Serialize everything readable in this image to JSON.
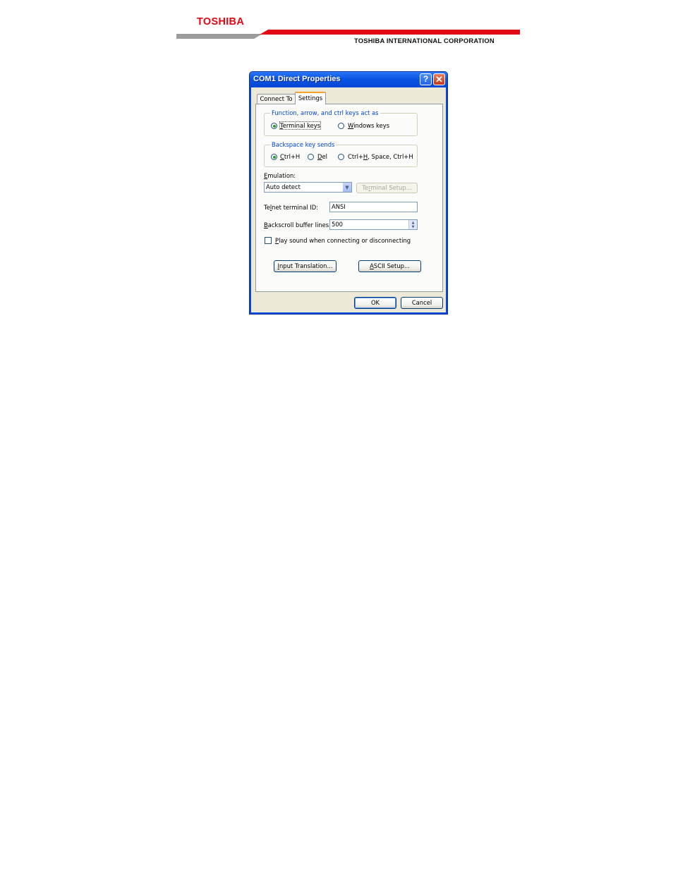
{
  "header": {
    "brand": "TOSHIBA",
    "corporation": "TOSHIBA INTERNATIONAL CORPORATION",
    "brand_color": "#e30613"
  },
  "dialog": {
    "title": "COM1 Direct Properties",
    "help_glyph": "?",
    "close_glyph": "✕",
    "tabs": [
      {
        "label": "Connect To",
        "active": false
      },
      {
        "label": "Settings",
        "active": true
      }
    ],
    "function_keys": {
      "legend": "Function, arrow, and ctrl keys act as",
      "options": [
        {
          "label": "Terminal keys",
          "mnemonic": "T",
          "selected": true
        },
        {
          "label": "Windows keys",
          "mnemonic": "W",
          "selected": false
        }
      ]
    },
    "backspace": {
      "legend": "Backspace key sends",
      "options": [
        {
          "label": "Ctrl+H",
          "mnemonic": "C",
          "selected": true
        },
        {
          "label": "Del",
          "mnemonic": "D",
          "selected": false
        },
        {
          "label": "Ctrl+H, Space, Ctrl+H",
          "mnemonic": "H",
          "selected": false
        }
      ]
    },
    "emulation": {
      "label": "Emulation:",
      "value": "Auto detect",
      "terminal_setup_button": "Terminal Setup..."
    },
    "telnet_id": {
      "label": "Telnet terminal ID:",
      "value": "ANSI"
    },
    "backscroll": {
      "label": "Backscroll buffer lines:",
      "value": "500"
    },
    "play_sound": {
      "label": "Play sound when connecting or disconnecting",
      "checked": false
    },
    "input_translation_button": "Input Translation...",
    "ascii_setup_button": "ASCII Setup...",
    "ok_button": "OK",
    "cancel_button": "Cancel"
  }
}
